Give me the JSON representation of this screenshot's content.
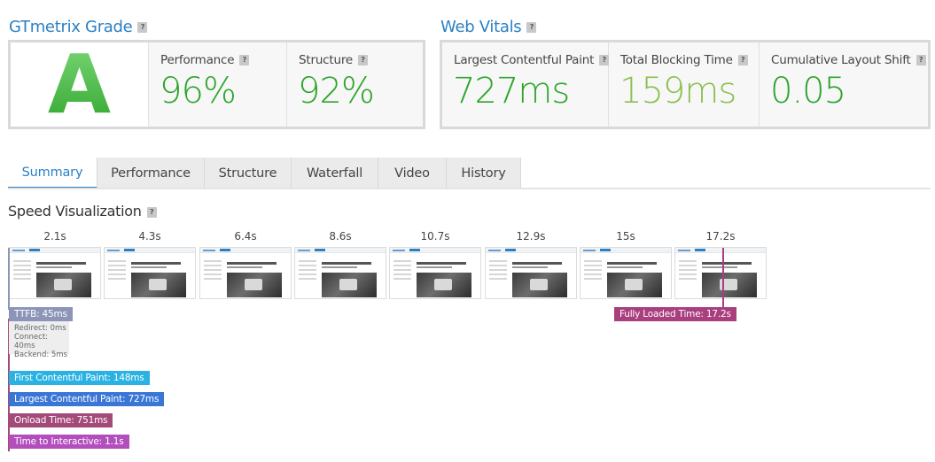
{
  "gtmetrix": {
    "title": "GTmetrix Grade",
    "help": "?",
    "grade": "A",
    "performance_label": "Performance",
    "performance_value": "96%",
    "structure_label": "Structure",
    "structure_value": "92%"
  },
  "web_vitals": {
    "title": "Web Vitals",
    "help": "?",
    "lcp_label": "Largest Contentful Paint",
    "lcp_value": "727ms",
    "tbt_label": "Total Blocking Time",
    "tbt_value": "159ms",
    "cls_label": "Cumulative Layout Shift",
    "cls_value": "0.05"
  },
  "colors": {
    "good_green": "#2ea52c",
    "ok_green": "#8cbf4f",
    "accent_blue": "#2c80c2",
    "ttfb": "#8c95b8",
    "fcp": "#2ab2e3",
    "lcp": "#3a76d6",
    "onload": "#a44a79",
    "tti": "#b24fbd",
    "fully_loaded": "#a93f7f"
  },
  "tabs": [
    "Summary",
    "Performance",
    "Structure",
    "Waterfall",
    "Video",
    "History"
  ],
  "speed": {
    "title": "Speed Visualization",
    "help": "?",
    "frame_times": [
      "2.1s",
      "4.3s",
      "6.4s",
      "8.6s",
      "10.7s",
      "12.9s",
      "15s",
      "17.2s"
    ]
  },
  "markers": {
    "ttfb": "TTFB: 45ms",
    "redirect": "Redirect: 0ms",
    "connect": "Connect: 40ms",
    "backend": "Backend: 5ms",
    "fcp": "First Contentful Paint: 148ms",
    "lcp": "Largest Contentful Paint: 727ms",
    "onload": "Onload Time: 751ms",
    "tti": "Time to Interactive: 1.1s",
    "fully_loaded": "Fully Loaded Time: 17.2s"
  }
}
